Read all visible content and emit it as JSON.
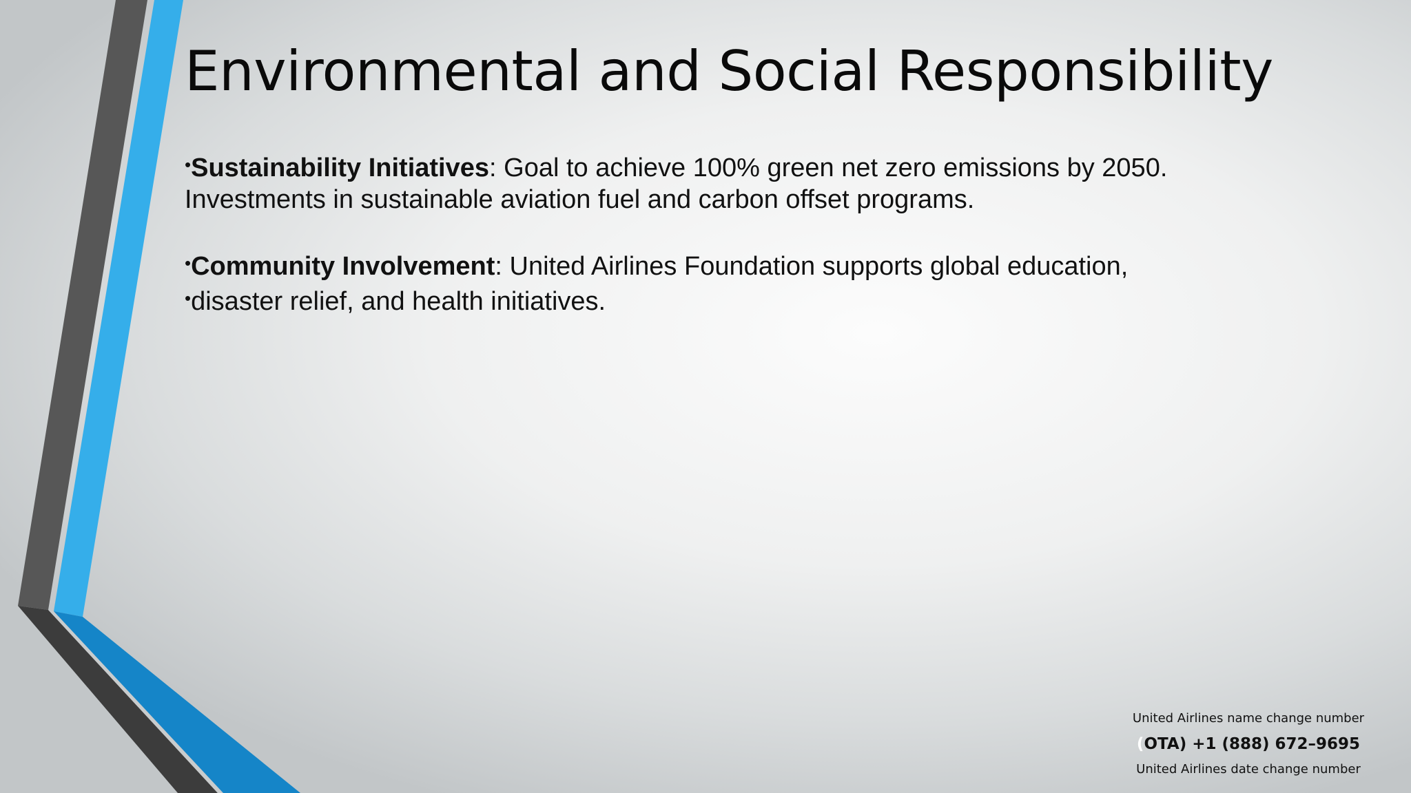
{
  "slide": {
    "title": "Environmental and Social Responsibility",
    "bullets": [
      {
        "bullet_char": "•",
        "bold": "Sustainability Initiatives",
        "text": ": Goal to achieve 100% green net zero emissions by 2050.",
        "continuation": "Investments in sustainable aviation fuel and carbon offset programs."
      },
      {
        "bullet_char": "•",
        "bold": "Community Involvement",
        "text": ": United Airlines Foundation supports global education,"
      },
      {
        "bullet_char": "•",
        "text": "disaster relief, and health initiatives."
      }
    ]
  },
  "footer": {
    "line1": "United Airlines name change number",
    "phone_paren": "(",
    "phone": "OTA) +1 (888) 672–9695",
    "line3": "United Airlines date change number"
  },
  "colors": {
    "accent_blue": "#35aeea",
    "accent_blue_dark": "#1585c8",
    "stripe_gray": "#575757",
    "stripe_dark": "#3c3c3c"
  }
}
